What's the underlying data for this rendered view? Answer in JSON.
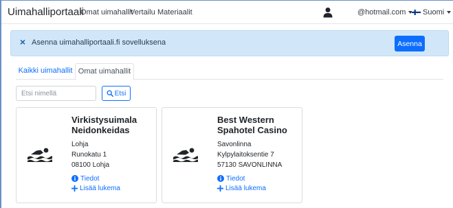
{
  "navbar": {
    "brand": "Uimahalliportaali",
    "links": [
      "Omat uimahallit",
      "Vertailu",
      "Materiaalit"
    ],
    "user_icon": "user-icon",
    "email": "@hotmail.com",
    "language": "Suomi"
  },
  "alert": {
    "close_label": "×",
    "text": "Asenna uimahalliportaali.fi sovelluksena",
    "install_label": "Asenna"
  },
  "tabs": {
    "all": "Kaikki uimahallit",
    "own": "Omat uimahallit"
  },
  "search": {
    "placeholder": "Etsi nimellä",
    "button_label": "Etsi"
  },
  "cards": [
    {
      "name": "Virkistysuimala Neidonkeidas",
      "city": "Lohja",
      "street": "Runokatu 1",
      "postal": "08100 Lohja",
      "info_label": "Tiedot",
      "add_label": "Lisää lukema"
    },
    {
      "name": "Best Western Spahotel Casino",
      "city": "Savonlinna",
      "street": "Kylpylaitoksentie 7",
      "postal": "57130 SAVONLINNA",
      "info_label": "Tiedot",
      "add_label": "Lisää lukema"
    }
  ],
  "colors": {
    "primary": "#0d6efd",
    "alert_bg": "#d1e7f9",
    "flag_blue": "#003580"
  }
}
